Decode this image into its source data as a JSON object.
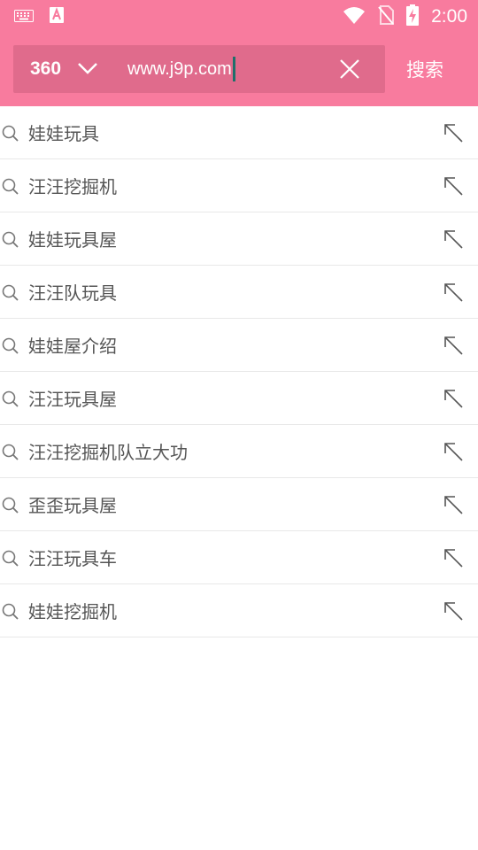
{
  "status_bar": {
    "time": "2:00",
    "left_icons": [
      "keyboard-icon",
      "font-app-icon"
    ],
    "right_icons": [
      "wifi-icon",
      "no-sim-icon",
      "battery-charging-icon"
    ]
  },
  "search": {
    "engine": "360",
    "query": "www.j9p.com",
    "search_button": "搜索"
  },
  "suggestions": [
    {
      "label": "娃娃玩具"
    },
    {
      "label": "汪汪挖掘机"
    },
    {
      "label": "娃娃玩具屋"
    },
    {
      "label": "汪汪队玩具"
    },
    {
      "label": "娃娃屋介绍"
    },
    {
      "label": "汪汪玩具屋"
    },
    {
      "label": "汪汪挖掘机队立大功"
    },
    {
      "label": "歪歪玩具屋"
    },
    {
      "label": "汪汪玩具车"
    },
    {
      "label": "娃娃挖掘机"
    }
  ],
  "colors": {
    "header": "#f87b9e",
    "searchbar": "#e06b8c",
    "caret": "#1f6f6a"
  }
}
